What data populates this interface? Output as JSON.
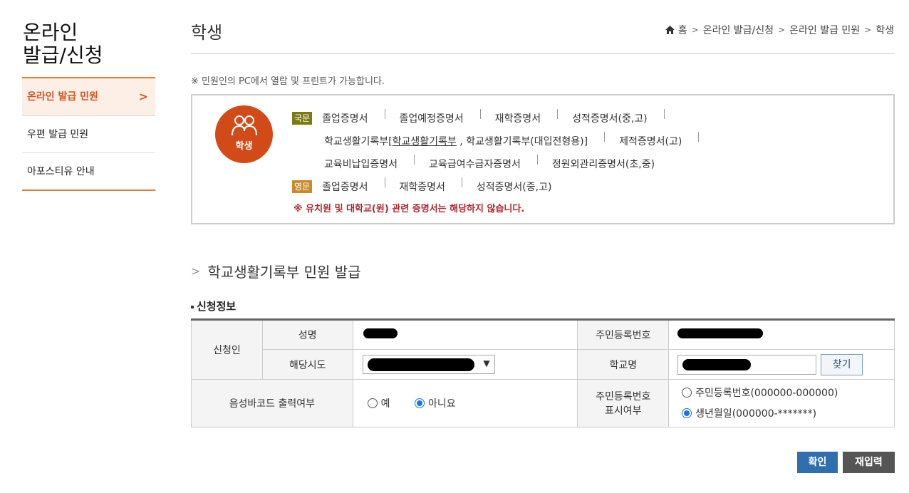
{
  "sidebar": {
    "title_line1": "온라인",
    "title_line2": "발급/신청",
    "items": [
      {
        "label": "온라인 발급 민원"
      },
      {
        "label": "우편 발급 민원"
      },
      {
        "label": "아포스티유 안내"
      }
    ],
    "active_chevron": ">"
  },
  "header": {
    "title": "학생",
    "breadcrumb": [
      "홈",
      "온라인 발급/신청",
      "온라인 발급 민원",
      "학생"
    ]
  },
  "notice": "※ 민원인의 PC에서 열람 및 프린트가 가능합니다.",
  "certs": {
    "badge_label": "학생",
    "kor_tag": "국문",
    "eng_tag": "영문",
    "kor_row1": [
      "졸업증명서",
      "졸업예정증명서",
      "재학증명서",
      "성적증명서(중,고)"
    ],
    "kor_row2_a": "학교생활기록부[",
    "kor_row2_link": "학교생활기록부",
    "kor_row2_b": " , 학교생활기록부(대입전형용)]",
    "kor_row2_c": "제적증명서(고)",
    "kor_row3": [
      "교육비납입증명서",
      "교육급여수급자증명서",
      "정원외관리증명서(초,중)"
    ],
    "eng_row": [
      "졸업증명서",
      "재학증명서",
      "성적증명서(중,고)"
    ],
    "warning": "※ 유치원 및 대학교(원) 관련 증명서는 해당하지 않습니다."
  },
  "section": {
    "title": "학교생활기록부 민원 발급",
    "subtitle": "신청정보"
  },
  "form": {
    "applicant": "신청인",
    "name_label": "성명",
    "rrn_label": "주민등록번호",
    "region_label": "해당시도",
    "school_label": "학교명",
    "find_button": "찾기",
    "barcode_label": "음성바코드 출력여부",
    "barcode_yes": "예",
    "barcode_no": "아니요",
    "rrn_display_label_1": "주민등록번호",
    "rrn_display_label_2": "표시여부",
    "rrn_opt_full": "주민등록번호(000000-000000)",
    "rrn_opt_birth": "생년월일(000000-*******)"
  },
  "buttons": {
    "confirm": "확인",
    "reset": "재입력"
  },
  "colors": {
    "accent": "#e07b39",
    "badge": "#d24a17",
    "confirm": "#2f6fae"
  }
}
